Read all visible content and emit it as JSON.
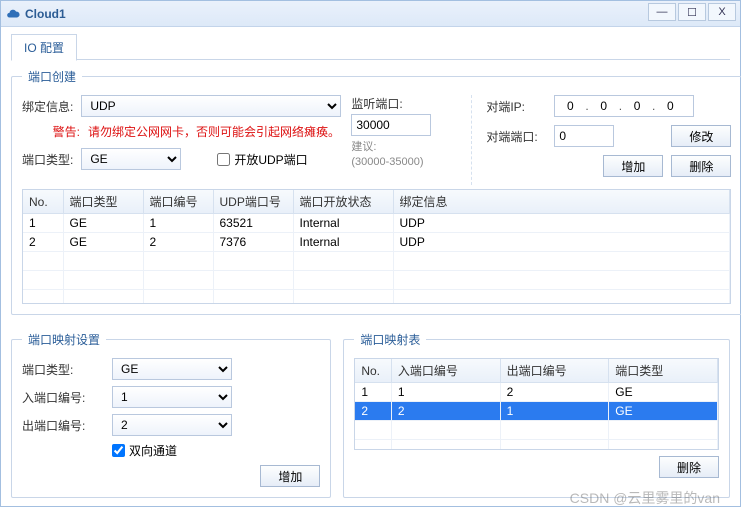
{
  "window": {
    "title": "Cloud1"
  },
  "tabs": {
    "io": "IO 配置"
  },
  "port_create": {
    "legend": "端口创建",
    "bind_label": "绑定信息:",
    "bind_value": "UDP",
    "warn_label": "警告:",
    "warn_text": "请勿绑定公网网卡，否则可能会引起网络瘫痪。",
    "port_type_label": "端口类型:",
    "port_type_value": "GE",
    "open_udp_label": "开放UDP端口",
    "listen_label": "监听端口:",
    "listen_value": "30000",
    "suggest_label": "建议:",
    "suggest_range": "(30000-35000)",
    "peer_ip_label": "对端IP:",
    "peer_ip": [
      "0",
      "0",
      "0",
      "0"
    ],
    "peer_port_label": "对端端口:",
    "peer_port_value": "0",
    "modify_btn": "修改",
    "add_btn": "增加",
    "delete_btn": "删除",
    "table": {
      "headers": [
        "No.",
        "端口类型",
        "端口编号",
        "UDP端口号",
        "端口开放状态",
        "绑定信息"
      ],
      "rows": [
        {
          "no": "1",
          "type": "GE",
          "idx": "1",
          "udp": "63521",
          "open": "Internal",
          "bind": "UDP"
        },
        {
          "no": "2",
          "type": "GE",
          "idx": "2",
          "udp": "7376",
          "open": "Internal",
          "bind": "UDP"
        }
      ]
    }
  },
  "map_settings": {
    "legend": "端口映射设置",
    "port_type_label": "端口类型:",
    "port_type_value": "GE",
    "in_label": "入端口编号:",
    "in_value": "1",
    "out_label": "出端口编号:",
    "out_value": "2",
    "bidir_label": "双向通道",
    "add_btn": "增加"
  },
  "map_table": {
    "legend": "端口映射表",
    "headers": [
      "No.",
      "入端口编号",
      "出端口编号",
      "端口类型"
    ],
    "rows": [
      {
        "no": "1",
        "in": "1",
        "out": "2",
        "type": "GE",
        "selected": false
      },
      {
        "no": "2",
        "in": "2",
        "out": "1",
        "type": "GE",
        "selected": true
      }
    ],
    "delete_btn": "删除"
  },
  "watermark": "CSDN @云里雾里的van"
}
